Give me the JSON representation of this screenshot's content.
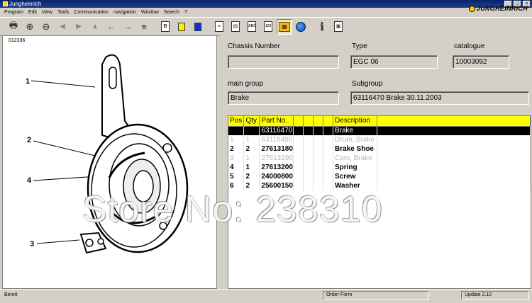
{
  "window": {
    "title": "Jungheinrich"
  },
  "menu": [
    "Program",
    "Edit",
    "View",
    "Tools",
    "Communication",
    "navigation",
    "Window",
    "Search",
    "?"
  ],
  "brand": {
    "logo_text": "JUNGHEINRICH"
  },
  "toolbar": {
    "buttons": [
      {
        "name": "print-icon",
        "glyph": "🖶"
      },
      {
        "name": "zoom-in-icon",
        "glyph": "⊕"
      },
      {
        "name": "zoom-out-icon",
        "glyph": "⊖"
      },
      {
        "name": "back-icon",
        "glyph": "◀"
      },
      {
        "name": "forward-icon",
        "glyph": "▶"
      },
      {
        "name": "up-icon",
        "glyph": "▲"
      },
      {
        "name": "arrow-left-icon",
        "glyph": "←"
      },
      {
        "name": "arrow-right-icon",
        "glyph": "→"
      },
      {
        "name": "list-icon",
        "glyph": "≡"
      }
    ]
  },
  "drawing": {
    "id": "012396",
    "callouts": [
      "1",
      "2",
      "4",
      "3"
    ]
  },
  "fields": {
    "chassis_label": "Chassis Number",
    "chassis_value": "",
    "type_label": "Type",
    "type_value": "EGC 06",
    "catalogue_label": "catalogue",
    "catalogue_value": "10003092",
    "main_group_label": "main group",
    "main_group_value": "Brake",
    "subgroup_label": "Subgroup",
    "subgroup_value": "63116470  Brake 30.11.2003"
  },
  "parts_table": {
    "headers": {
      "pos": "Pos",
      "qty": "Qty",
      "part": "Part No.",
      "desc": "Description"
    },
    "rows": [
      {
        "pos": "",
        "qty": "",
        "part": "63116470",
        "desc": "Brake",
        "style": "selected"
      },
      {
        "pos": "1",
        "qty": "1",
        "part": "63116480",
        "desc": "Drum, Brake",
        "style": "dim"
      },
      {
        "pos": "2",
        "qty": "2",
        "part": "27613180",
        "desc": "Brake Shoe",
        "style": "bold"
      },
      {
        "pos": "3",
        "qty": "1",
        "part": "27613190",
        "desc": "Cam, Brake",
        "style": "dim"
      },
      {
        "pos": "4",
        "qty": "1",
        "part": "27613200",
        "desc": "Spring",
        "style": "bold"
      },
      {
        "pos": "5",
        "qty": "2",
        "part": "24000800",
        "desc": "Screw",
        "style": "bold"
      },
      {
        "pos": "6",
        "qty": "2",
        "part": "25600150",
        "desc": "Washer",
        "style": "bold"
      }
    ]
  },
  "watermark": "Store No: 238310",
  "status": {
    "left": "Bereit",
    "middle": "Order Form",
    "right": "Update 2.10"
  }
}
